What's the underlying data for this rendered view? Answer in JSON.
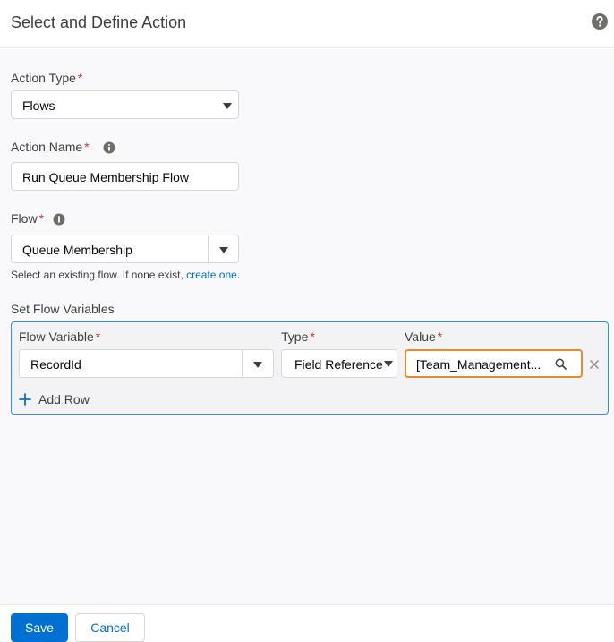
{
  "header": {
    "title": "Select and Define Action",
    "help_icon": "help-icon"
  },
  "form": {
    "required_marker": "*",
    "action_type": {
      "label": "Action Type",
      "value": "Flows"
    },
    "action_name": {
      "label": "Action Name",
      "value": "Run Queue Membership Flow"
    },
    "flow": {
      "label": "Flow",
      "value": "Queue Membership",
      "help_prefix": "Select an existing flow. If none exist,",
      "help_link": "create one",
      "help_suffix": "."
    }
  },
  "flow_variables": {
    "section_label": "Set Flow Variables",
    "columns": {
      "variable": "Flow Variable",
      "type": "Type",
      "value": "Value"
    },
    "rows": [
      {
        "variable": "RecordId",
        "type": "Field Reference",
        "value": "[Team_Management..."
      }
    ],
    "add_row_label": "Add Row"
  },
  "footer": {
    "save_label": "Save",
    "cancel_label": "Cancel"
  },
  "colors": {
    "brand": "#0070d2",
    "required": "#c23934",
    "panel_border": "#1b96ff",
    "focus_border": "#ea8a2e",
    "link": "#006dcc"
  }
}
